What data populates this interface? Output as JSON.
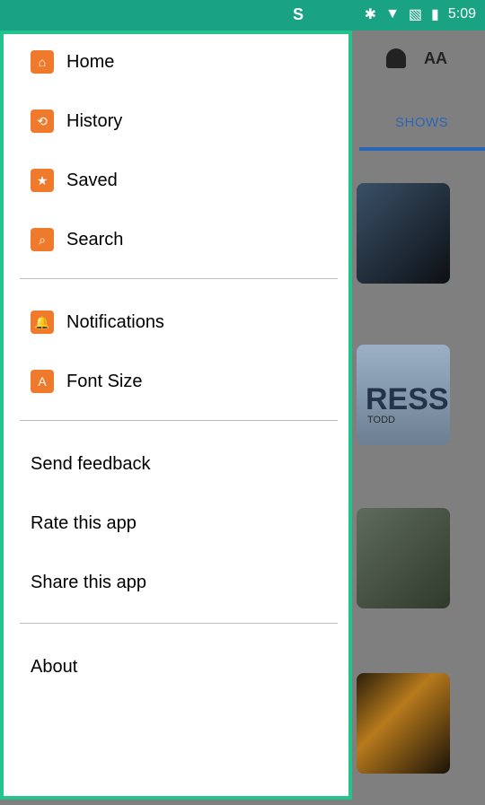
{
  "status": {
    "time": "5:09",
    "icons": [
      "bluetooth-icon",
      "wifi-icon",
      "no-sim-icon",
      "battery-icon"
    ],
    "app_symbol": "S"
  },
  "background": {
    "tab_label": "SHOWS",
    "font_size_glyph": "AA",
    "card_press_text": "RESS",
    "card_press_sub": "TODD"
  },
  "drawer": {
    "section1": [
      {
        "label": "Home",
        "icon": "home-icon",
        "glyph": "⌂"
      },
      {
        "label": "History",
        "icon": "history-icon",
        "glyph": "⟲"
      },
      {
        "label": "Saved",
        "icon": "star-icon",
        "glyph": "★"
      },
      {
        "label": "Search",
        "icon": "search-icon",
        "glyph": "⌕"
      }
    ],
    "section2": [
      {
        "label": "Notifications",
        "icon": "bell-icon",
        "glyph": "🔔"
      },
      {
        "label": "Font Size",
        "icon": "font-size-icon",
        "glyph": "A"
      }
    ],
    "section3": [
      {
        "label": "Send feedback"
      },
      {
        "label": "Rate this app"
      },
      {
        "label": "Share this app"
      }
    ],
    "section4": [
      {
        "label": "About"
      }
    ]
  },
  "colors": {
    "statusbar": "#1aa383",
    "drawer_border": "#22c38d",
    "icon_bg": "#f07a2b",
    "tab_accent": "#2a66b7"
  }
}
